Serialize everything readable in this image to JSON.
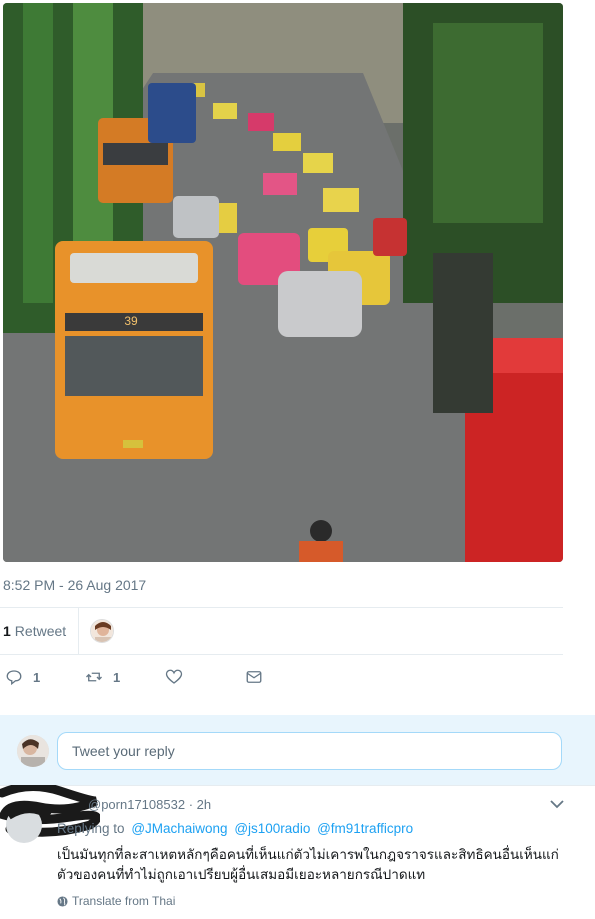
{
  "photo": {
    "description_icon": "traffic-photo-icon",
    "bus_route_number": "39"
  },
  "tweet": {
    "timestamp": "8:52 PM - 26 Aug 2017",
    "retweet_count": "1",
    "retweet_label": "Retweet"
  },
  "actions": {
    "reply_count": "1",
    "retweet_count": "1"
  },
  "reply_box": {
    "placeholder": "Tweet your reply"
  },
  "reply": {
    "handle": "@porn17108532",
    "time": "· 2h",
    "replying_to_label": "Replying to",
    "mentions": [
      "@JMachaiwong",
      "@js100radio",
      "@fm91trafficpro"
    ],
    "text": "เป็นมันทุกที่ละสาเหตหลักๆคือคนที่เห็นแก่ตัวไม่เคารพในกฎจราจรและสิทธิคนอื่นเห็นแก่ตัวของคนที่ทำไม่ถูกเอาเปรียบผู้อื่นเสมอมีเยอะหลายกรณีปาดแท",
    "translate_label": "Translate from Thai"
  },
  "colors": {
    "link": "#1da1f2",
    "muted": "#657786",
    "reply_bg": "#e8f5fd",
    "bus": "#e8922a"
  }
}
